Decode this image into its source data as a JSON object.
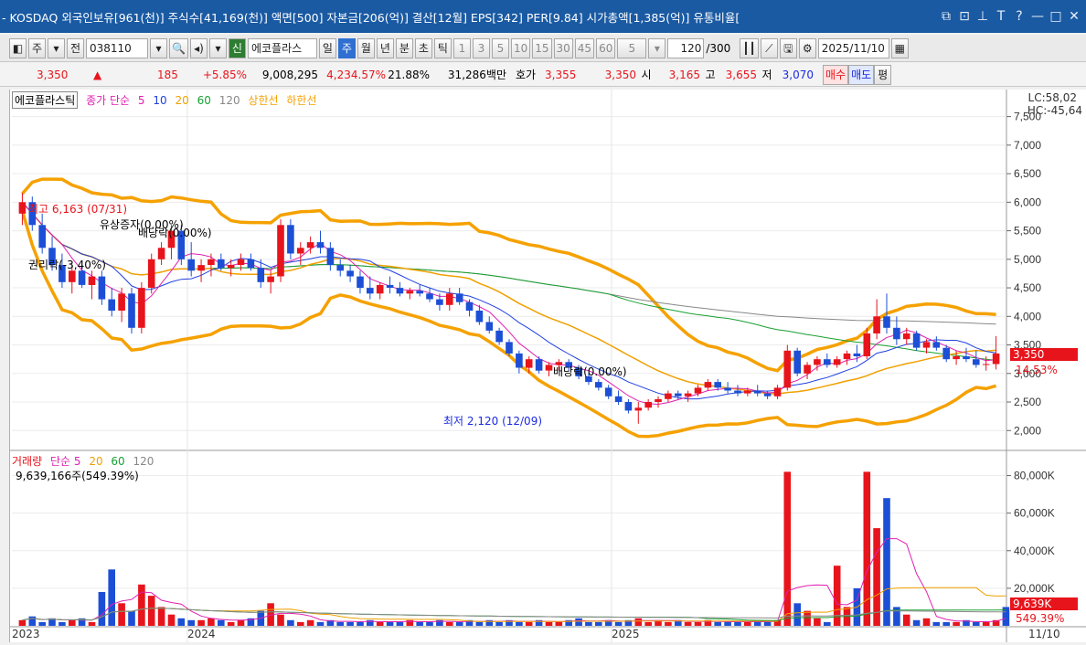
{
  "titlebar": {
    "title": "- KOSDAQ 외국인보유[961(천)] 주식수[41,169(천)] 액면[500] 자본금[206(억)] 결산[12월] EPS[342] PER[9.84] 시가총액[1,385(억)] 유통비율[",
    "icons": [
      "restore-icon",
      "popout-icon",
      "pin-icon",
      "font-icon",
      "help-icon",
      "minimize-icon",
      "maximize-icon",
      "close-icon"
    ]
  },
  "toolbar": {
    "mode": "주",
    "prev": "전",
    "code": "038110",
    "new_label": "신",
    "stock_name": "에코플라스",
    "periods": [
      "일",
      "주",
      "월",
      "년",
      "분",
      "초",
      "틱"
    ],
    "active_period": "주",
    "intervals": [
      "1",
      "3",
      "5",
      "10",
      "15",
      "30",
      "45",
      "60"
    ],
    "count_sel": "5",
    "range": "120",
    "range_total": "/300",
    "date": "2025/11/10"
  },
  "quote": {
    "price": "3,350",
    "arrow": "▲",
    "change": "185",
    "change_pct": "+5.85%",
    "volume": "9,008,295",
    "vol_ratio": "4,234.57%",
    "turnover": "21.88%",
    "amount": "31,286백만",
    "hoga_label": "호가",
    "ask": "3,355",
    "bid": "3,350",
    "open_label": "시",
    "open": "3,165",
    "high_label": "고",
    "high": "3,655",
    "low_label": "저",
    "low": "3,070",
    "buy_label": "매수",
    "sell_label": "매도",
    "eval_label": "평"
  },
  "price_legend": {
    "name": "에코플라스틱",
    "close": "종가 단순",
    "ma": [
      "5",
      "10",
      "20",
      "60",
      "120"
    ],
    "upper": "상한선",
    "lower": "하한선",
    "lc": "LC:58,02",
    "hc": "HC:-45,64"
  },
  "annotations": {
    "high": "최고 6,163 (07/31)",
    "low": "최저 2,120 (12/09)",
    "rights": "유상증자(0.00%)",
    "div1": "배당락(0.00%)",
    "div2": "배당락(0.00%)",
    "drop": "권리락(-3,40%)",
    "last_price": "3,350",
    "last_pct": "14.53%"
  },
  "volume_legend": {
    "name": "거래량",
    "ma_label": "단순 5",
    "ma": [
      "20",
      "60",
      "120"
    ],
    "value": "9,639,166주(549.39%)",
    "last_vol": "9,639K",
    "last_pct": "549.39%"
  },
  "x_labels": [
    "2023",
    "2024",
    "2025",
    "11/10"
  ],
  "colors": {
    "up": "#e8141c",
    "down": "#1c4fd6",
    "band": "#f5a100",
    "ma5": "#e020b0",
    "ma10": "#2040e0",
    "ma20": "#f0a000",
    "ma60": "#18a030",
    "ma120": "#888888"
  },
  "chart_data": {
    "type": "candlestick",
    "y_axis_price": [
      7500,
      7000,
      6500,
      6000,
      5500,
      5000,
      4500,
      4000,
      3500,
      3000,
      2500,
      2000
    ],
    "y_axis_volume": [
      "80,000K",
      "60,000K",
      "40,000K",
      "20,000K"
    ],
    "ohlc_weeks": [
      [
        5800,
        6163,
        5600,
        6000
      ],
      [
        6000,
        6100,
        5500,
        5600
      ],
      [
        5600,
        5800,
        5100,
        5200
      ],
      [
        5200,
        5400,
        4800,
        4900
      ],
      [
        4900,
        5100,
        4500,
        4600
      ],
      [
        4600,
        4900,
        4400,
        4800
      ],
      [
        4800,
        4900,
        4500,
        4550
      ],
      [
        4550,
        4800,
        4300,
        4700
      ],
      [
        4700,
        4800,
        4200,
        4300
      ],
      [
        4300,
        4500,
        4000,
        4100
      ],
      [
        4100,
        4500,
        3900,
        4400
      ],
      [
        4400,
        4500,
        3700,
        3800
      ],
      [
        3800,
        4600,
        3700,
        4500
      ],
      [
        4500,
        5100,
        4400,
        5000
      ],
      [
        5000,
        5300,
        4900,
        5200
      ],
      [
        5200,
        5600,
        5000,
        5500
      ],
      [
        5500,
        5600,
        4900,
        5000
      ],
      [
        5000,
        5300,
        4700,
        4800
      ],
      [
        4800,
        5000,
        4600,
        4900
      ],
      [
        4900,
        5100,
        4700,
        5000
      ],
      [
        5000,
        5100,
        4800,
        4850
      ],
      [
        4850,
        5000,
        4700,
        4900
      ],
      [
        4900,
        5100,
        4800,
        5000
      ],
      [
        5000,
        5100,
        4800,
        4850
      ],
      [
        4850,
        5000,
        4500,
        4600
      ],
      [
        4600,
        4800,
        4400,
        4700
      ],
      [
        4700,
        5700,
        4600,
        5600
      ],
      [
        5600,
        5700,
        5000,
        5100
      ],
      [
        5100,
        5300,
        4900,
        5200
      ],
      [
        5200,
        5400,
        5100,
        5300
      ],
      [
        5300,
        5500,
        5100,
        5200
      ],
      [
        5200,
        5300,
        4800,
        4900
      ],
      [
        4900,
        5000,
        4700,
        4800
      ],
      [
        4800,
        4900,
        4600,
        4700
      ],
      [
        4700,
        4800,
        4400,
        4500
      ],
      [
        4500,
        4700,
        4300,
        4400
      ],
      [
        4400,
        4600,
        4300,
        4550
      ],
      [
        4550,
        4700,
        4400,
        4500
      ],
      [
        4500,
        4600,
        4350,
        4400
      ],
      [
        4400,
        4500,
        4300,
        4450
      ],
      [
        4450,
        4550,
        4350,
        4400
      ],
      [
        4400,
        4500,
        4250,
        4300
      ],
      [
        4300,
        4400,
        4100,
        4200
      ],
      [
        4200,
        4500,
        4100,
        4400
      ],
      [
        4400,
        4500,
        4200,
        4250
      ],
      [
        4250,
        4300,
        4000,
        4100
      ],
      [
        4100,
        4200,
        3850,
        3900
      ],
      [
        3900,
        4000,
        3700,
        3750
      ],
      [
        3750,
        3800,
        3500,
        3550
      ],
      [
        3550,
        3600,
        3300,
        3350
      ],
      [
        3350,
        3400,
        3000,
        3100
      ],
      [
        3100,
        3300,
        3000,
        3250
      ],
      [
        3250,
        3300,
        3000,
        3050
      ],
      [
        3050,
        3200,
        2950,
        3150
      ],
      [
        3150,
        3250,
        3050,
        3200
      ],
      [
        3200,
        3250,
        3050,
        3100
      ],
      [
        3100,
        3150,
        2900,
        2950
      ],
      [
        2950,
        3000,
        2800,
        2850
      ],
      [
        2850,
        2900,
        2700,
        2750
      ],
      [
        2750,
        2800,
        2550,
        2600
      ],
      [
        2600,
        2700,
        2450,
        2500
      ],
      [
        2500,
        2550,
        2300,
        2350
      ],
      [
        2350,
        2500,
        2120,
        2400
      ],
      [
        2400,
        2550,
        2350,
        2500
      ],
      [
        2500,
        2600,
        2400,
        2550
      ],
      [
        2550,
        2700,
        2500,
        2650
      ],
      [
        2650,
        2700,
        2550,
        2600
      ],
      [
        2600,
        2700,
        2500,
        2650
      ],
      [
        2650,
        2800,
        2600,
        2750
      ],
      [
        2750,
        2900,
        2700,
        2850
      ],
      [
        2850,
        2900,
        2700,
        2750
      ],
      [
        2750,
        2850,
        2650,
        2700
      ],
      [
        2700,
        2800,
        2600,
        2650
      ],
      [
        2650,
        2750,
        2600,
        2700
      ],
      [
        2700,
        2800,
        2600,
        2650
      ],
      [
        2650,
        2700,
        2550,
        2600
      ],
      [
        2600,
        2800,
        2550,
        2750
      ],
      [
        2750,
        3500,
        2700,
        3400
      ],
      [
        3400,
        3450,
        2950,
        3000
      ],
      [
        3000,
        3200,
        2900,
        3150
      ],
      [
        3150,
        3300,
        3050,
        3250
      ],
      [
        3250,
        3350,
        3100,
        3150
      ],
      [
        3150,
        3300,
        3100,
        3250
      ],
      [
        3250,
        3400,
        3150,
        3350
      ],
      [
        3350,
        3500,
        3200,
        3300
      ],
      [
        3300,
        3800,
        3250,
        3700
      ],
      [
        3700,
        4300,
        3600,
        4000
      ],
      [
        4000,
        4400,
        3700,
        3800
      ],
      [
        3800,
        4000,
        3500,
        3600
      ],
      [
        3600,
        3800,
        3500,
        3700
      ],
      [
        3700,
        3750,
        3400,
        3450
      ],
      [
        3450,
        3600,
        3350,
        3550
      ],
      [
        3550,
        3650,
        3400,
        3450
      ],
      [
        3450,
        3500,
        3200,
        3250
      ],
      [
        3250,
        3400,
        3150,
        3300
      ],
      [
        3300,
        3450,
        3200,
        3250
      ],
      [
        3250,
        3400,
        3100,
        3150
      ],
      [
        3150,
        3300,
        3050,
        3165
      ],
      [
        3165,
        3655,
        3070,
        3350
      ]
    ],
    "volumes_k": [
      3,
      5,
      2,
      4,
      2,
      3,
      4,
      2,
      18,
      30,
      12,
      8,
      22,
      16,
      10,
      6,
      4,
      3,
      3,
      4,
      3,
      2,
      3,
      4,
      8,
      12,
      6,
      3,
      2,
      3,
      2,
      3,
      2,
      2,
      2,
      3,
      2,
      2,
      2,
      3,
      2,
      2,
      3,
      2,
      2,
      3,
      2,
      3,
      2,
      3,
      2,
      2,
      3,
      2,
      2,
      3,
      4,
      2,
      2,
      3,
      2,
      3,
      4,
      2,
      3,
      2,
      3,
      2,
      2,
      3,
      2,
      2,
      2,
      2,
      3,
      2,
      3,
      82,
      12,
      8,
      4,
      2,
      32,
      10,
      20,
      82,
      52,
      68,
      10,
      6,
      3,
      4,
      2,
      2,
      2,
      3,
      2,
      2,
      3,
      10
    ]
  }
}
